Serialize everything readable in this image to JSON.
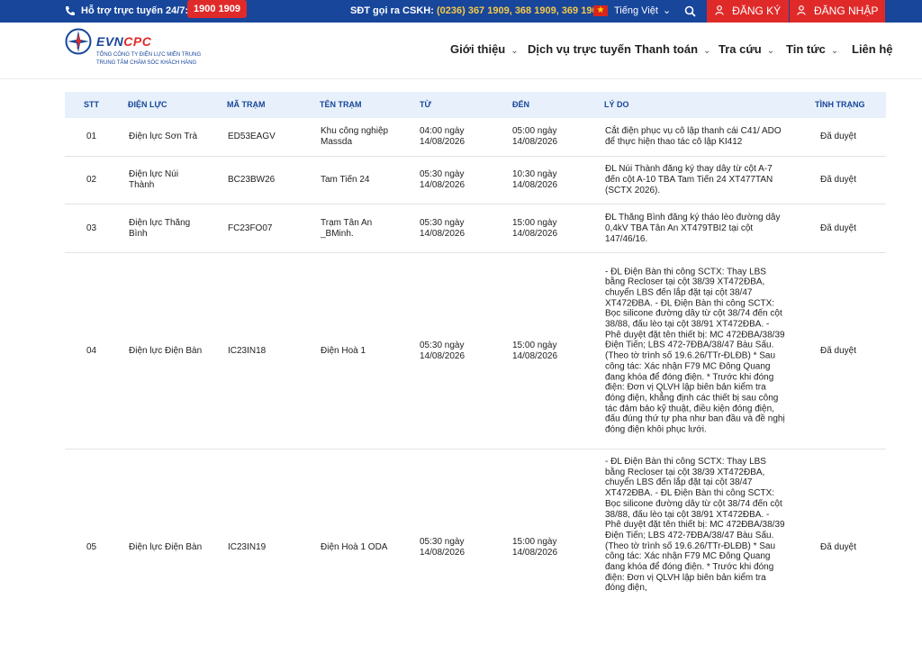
{
  "topbar": {
    "support_label": "Hỗ trợ trực tuyến 24/7:",
    "hotline": "1900 1909",
    "cskh_label": "SĐT gọi ra CSKH:",
    "cskh_numbers": "(0236) 367 1909, 368 1909, 369 1909",
    "language": "Tiếng Việt",
    "register": "ĐĂNG KÝ",
    "login": "ĐĂNG NHẬP"
  },
  "header": {
    "brand_evn": "EVN",
    "brand_cpc": "CPC",
    "subtitle1": "TỔNG CÔNG TY ĐIỆN LỰC MIỀN TRUNG",
    "subtitle2": "TRUNG TÂM CHĂM SÓC KHÁCH HÀNG",
    "nav": [
      "Giới thiệu",
      "Dịch vụ trực tuyến",
      "Thanh toán",
      "Tra cứu",
      "Tin tức",
      "Liên hệ"
    ]
  },
  "table": {
    "headers": [
      "STT",
      "ĐIỆN LỰC",
      "MÃ TRẠM",
      "TÊN TRẠM",
      "TỪ",
      "ĐẾN",
      "LÝ DO",
      "TÌNH TRẠNG"
    ],
    "rows": [
      {
        "stt": "01",
        "dien_luc": "Điện lực Sơn Trà",
        "ma_tram": "ED53EAGV",
        "ten_tram": "Khu công nghiệp Massda",
        "tu": "04:00 ngày 14/08/2026",
        "den": "05:00 ngày 14/08/2026",
        "ly_do": "Cắt điện phục vụ cô lập thanh cái C41/ ADO để thực hiện thao tác cô lập KI412",
        "tinh_trang": "Đã duyệt"
      },
      {
        "stt": "02",
        "dien_luc": "Điện lực Núi Thành",
        "ma_tram": "BC23BW26",
        "ten_tram": "Tam Tiến 24",
        "tu": "05:30 ngày 14/08/2026",
        "den": "10:30 ngày 14/08/2026",
        "ly_do": "ĐL Núi Thành đăng ký thay dây từ cột A-7 đến cột A-10 TBA Tam Tiến 24 XT477TAN (SCTX 2026).",
        "tinh_trang": "Đã duyệt"
      },
      {
        "stt": "03",
        "dien_luc": "Điện lực Thăng Bình",
        "ma_tram": "FC23FO07",
        "ten_tram": "Trạm Tân An _BMinh.",
        "tu": "05:30 ngày 14/08/2026",
        "den": "15:00 ngày 14/08/2026",
        "ly_do": "ĐL Thăng Bình đăng ký tháo lèo đường dây 0,4kV TBA Tân An XT479TBI2 tại cột 147/46/16.",
        "tinh_trang": "Đã duyệt"
      },
      {
        "stt": "04",
        "dien_luc": "Điện lực Điện Bàn",
        "ma_tram": "IC23IN18",
        "ten_tram": "Điện Hoà 1",
        "tu": "05:30 ngày 14/08/2026",
        "den": "15:00 ngày 14/08/2026",
        "ly_do": "- ĐL Điện Bàn thi công SCTX: Thay LBS bằng Recloser tại cột 38/39 XT472ĐBA, chuyển LBS đến lắp đặt tại cột 38/47 XT472ĐBA. - ĐL Điện Bàn thi công SCTX: Bọc silicone đường dây từ cột 38/74 đến cột 38/88, đấu lèo tại cột 38/91 XT472ĐBA. - Phê duyệt đặt tên thiết bị: MC 472ĐBA/38/39 Điện Tiến; LBS 472-7ĐBA/38/47 Bàu Sấu. (Theo tờ trình số 19.6.26/TTr-ĐLĐB) * Sau công tác: Xác nhận F79 MC Đông Quang đang khóa để đóng điện. * Trước khi đóng điện: Đơn vị QLVH lập biên bản kiểm tra đóng điện, khẳng định các thiết bị sau công tác đảm bảo kỹ thuật, điều kiện đóng điện, đấu đúng thứ tự pha như ban đầu và đề nghị đóng điện khôi phục lưới.",
        "tinh_trang": "Đã duyệt"
      },
      {
        "stt": "05",
        "dien_luc": "Điện lực Điện Bàn",
        "ma_tram": "IC23IN19",
        "ten_tram": "Điện Hoà 1 ODA",
        "tu": "05:30 ngày 14/08/2026",
        "den": "15:00 ngày 14/08/2026",
        "ly_do": "- ĐL Điện Bàn thi công SCTX: Thay LBS bằng Recloser tại cột 38/39 XT472ĐBA, chuyển LBS đến lắp đặt tại cột 38/47 XT472ĐBA. - ĐL Điện Bàn thi công SCTX: Bọc silicone đường dây từ cột 38/74 đến cột 38/88, đấu lèo tại cột 38/91 XT472ĐBA. - Phê duyệt đặt tên thiết bị: MC 472ĐBA/38/39 Điện Tiến; LBS 472-7ĐBA/38/47 Bàu Sấu. (Theo tờ trình số 19.6.26/TTr-ĐLĐB) * Sau công tác: Xác nhận F79 MC Đông Quang đang khóa để đóng điện. * Trước khi đóng điện: Đơn vị QLVH lập biên bản kiểm tra đóng điện,",
        "tinh_trang": "Đã duyệt"
      }
    ]
  }
}
